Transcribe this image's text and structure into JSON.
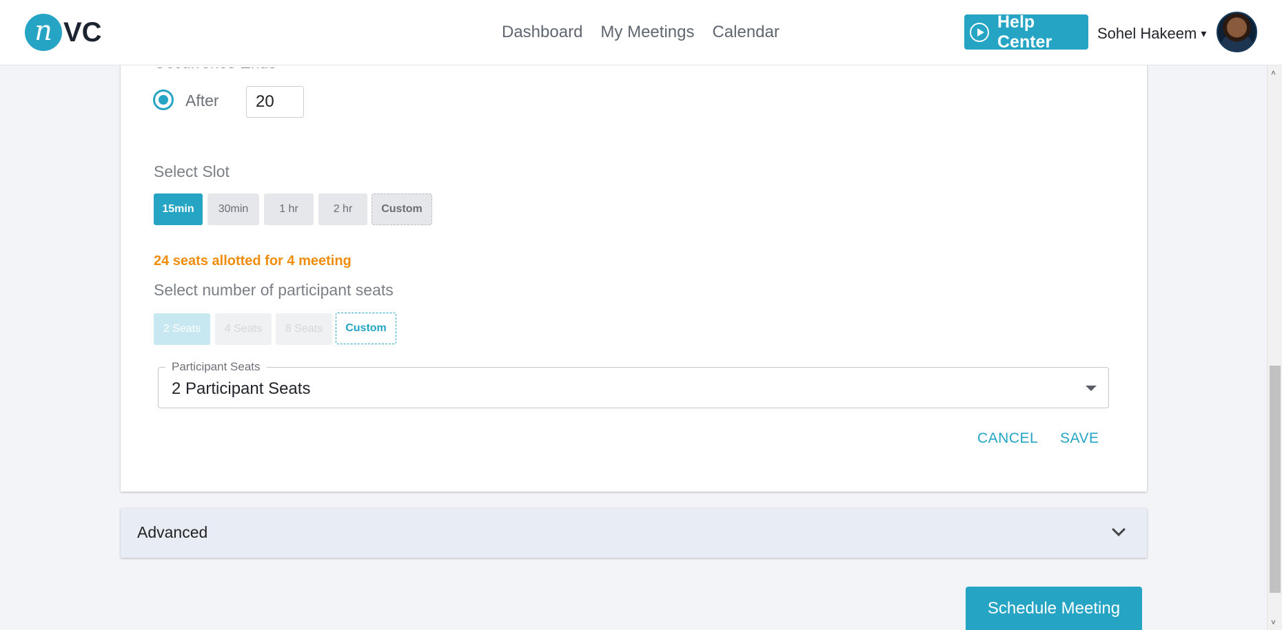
{
  "header": {
    "logo_initial": "n",
    "logo_text": "VC",
    "nav": [
      "Dashboard",
      "My Meetings",
      "Calendar"
    ],
    "help_label": "Help Center",
    "user_name": "Sohel Hakeem",
    "user_caret": "▾"
  },
  "recurrence": {
    "section_label": "Occurrence Ends",
    "option_label": "After",
    "after_value": "20"
  },
  "slot": {
    "title": "Select Slot",
    "options": [
      "15min",
      "30min",
      "1 hr",
      "2 hr",
      "Custom"
    ],
    "selected": "15min"
  },
  "seats": {
    "note": "24 seats allotted for 4 meeting",
    "title": "Select number of participant seats",
    "options": [
      "2 Seats",
      "4 Seats",
      "8 Seats",
      "Custom"
    ],
    "selected": "Custom",
    "field_label": "Participant Seats",
    "field_value": "2 Participant Seats"
  },
  "actions": {
    "cancel": "CANCEL",
    "save": "SAVE"
  },
  "advanced": {
    "label": "Advanced"
  },
  "footer": {
    "schedule": "Schedule Meeting"
  },
  "colors": {
    "accent": "#25a4c4",
    "warning": "#f08c0c",
    "page_bg": "#f2f4f8"
  },
  "icons": [
    "play-circle-icon",
    "caret-down-icon",
    "chevron-down-icon",
    "dropdown-arrow-icon"
  ]
}
